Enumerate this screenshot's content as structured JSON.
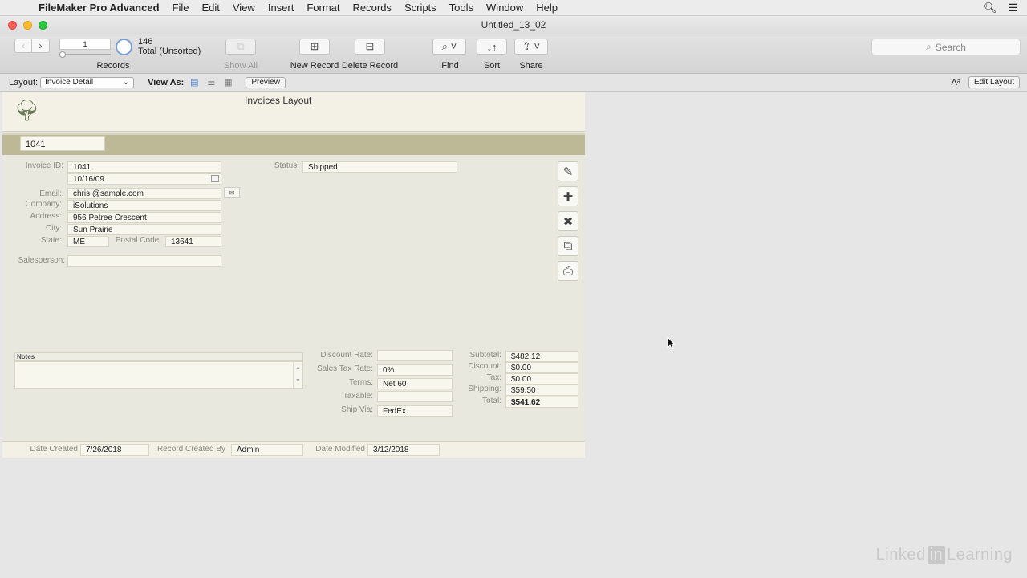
{
  "menubar": {
    "app_name": "FileMaker Pro Advanced",
    "items": [
      "File",
      "Edit",
      "View",
      "Insert",
      "Format",
      "Records",
      "Scripts",
      "Tools",
      "Window",
      "Help"
    ]
  },
  "window": {
    "title": "Untitled_13_02"
  },
  "toolbar": {
    "record_number": "1",
    "record_count": "146",
    "record_status": "Total (Unsorted)",
    "records_label": "Records",
    "show_all_label": "Show All",
    "new_record_label": "New Record",
    "delete_record_label": "Delete Record",
    "find_label": "Find",
    "sort_label": "Sort",
    "share_label": "Share",
    "search_placeholder": "Search"
  },
  "layout_bar": {
    "layout_label": "Layout:",
    "layout_value": "Invoice Detail",
    "view_as_label": "View As:",
    "preview_label": "Preview",
    "edit_layout_label": "Edit Layout"
  },
  "form": {
    "layout_title": "Invoices Layout",
    "header_id": "1041",
    "labels": {
      "invoice_id": "Invoice ID:",
      "email": "Email:",
      "company": "Company:",
      "address": "Address:",
      "city": "City:",
      "state": "State:",
      "postal_code": "Postal Code:",
      "salesperson": "Salesperson:",
      "status": "Status:",
      "notes": "Notes",
      "discount_rate": "Discount Rate:",
      "sales_tax_rate": "Sales Tax Rate:",
      "terms": "Terms:",
      "taxable": "Taxable:",
      "ship_via": "Ship Via:",
      "subtotal": "Subtotal:",
      "discount": "Discount:",
      "tax": "Tax:",
      "shipping": "Shipping:",
      "total": "Total:",
      "date_created": "Date Created",
      "record_created_by": "Record Created By",
      "date_modified": "Date Modified"
    },
    "values": {
      "invoice_id": "1041",
      "date": "10/16/09",
      "email": "chris @sample.com",
      "company": "iSolutions",
      "address": "956 Petree Crescent",
      "city": "Sun Prairie",
      "state": "ME",
      "postal_code": "13641",
      "salesperson": "",
      "status": "Shipped",
      "notes": "",
      "discount_rate": "",
      "sales_tax_rate": "0%",
      "terms": "Net 60",
      "taxable": "",
      "ship_via": "FedEx",
      "subtotal": "$482.12",
      "discount": "$0.00",
      "tax": "$0.00",
      "shipping": "$59.50",
      "total": "$541.62",
      "date_created": "7/26/2018",
      "record_created_by": "Admin",
      "date_modified": "3/12/2018"
    }
  },
  "watermark": {
    "part1": "Linked",
    "part2": "in",
    "part3": "Learning"
  }
}
